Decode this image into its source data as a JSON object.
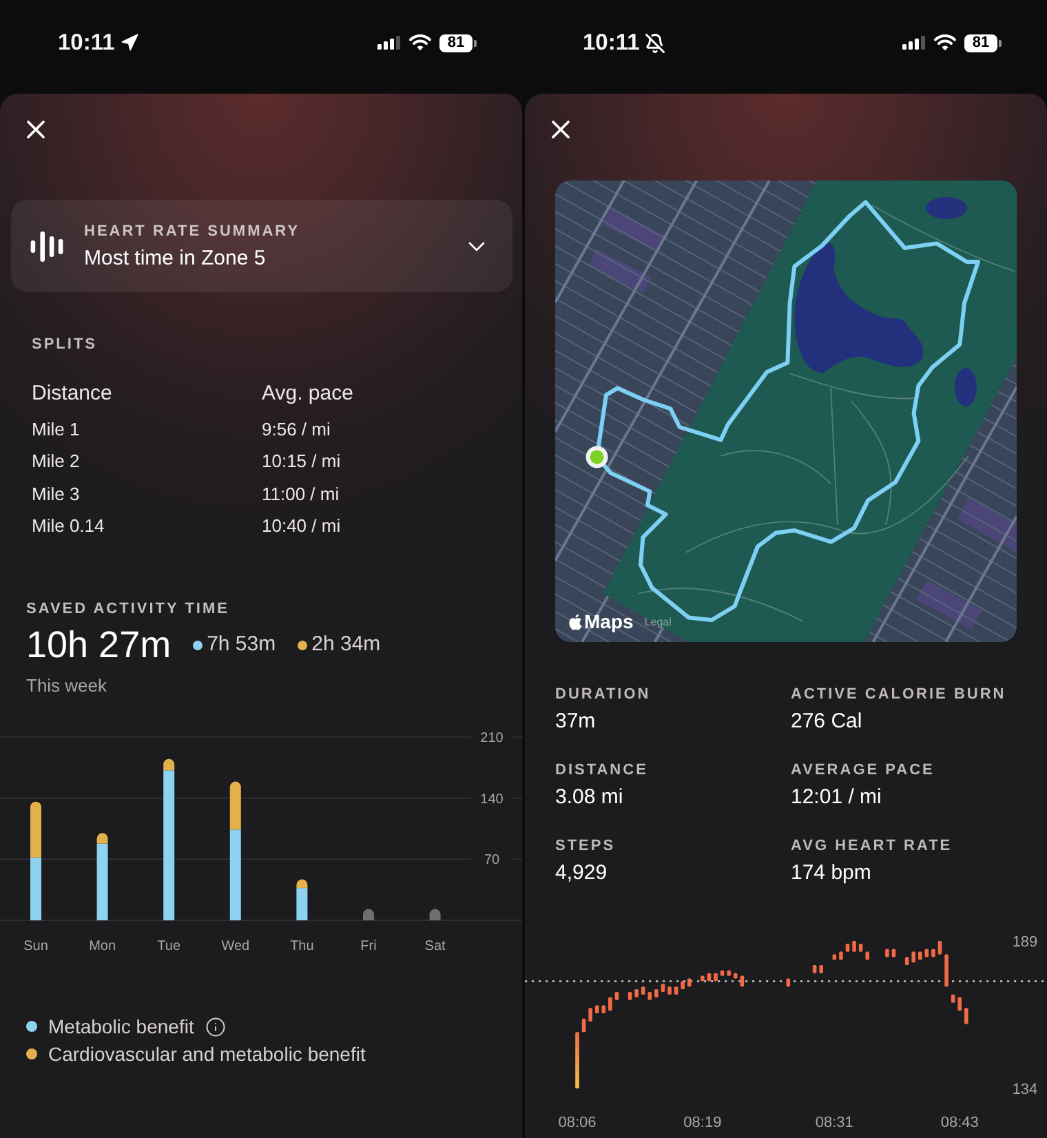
{
  "left_screen": {
    "status_bar": {
      "time": "10:11",
      "battery": "81"
    },
    "heart_rate_summary": {
      "title": "HEART RATE SUMMARY",
      "subtitle": "Most time in Zone 5",
      "expanded": false
    },
    "splits": {
      "title": "SPLITS",
      "columns": [
        "Distance",
        "Avg. pace"
      ],
      "rows": [
        [
          "Mile 1",
          "9:56 / mi"
        ],
        [
          "Mile 2",
          "10:15 / mi"
        ],
        [
          "Mile 3",
          "11:00 / mi"
        ],
        [
          "Mile 0.14",
          "10:40 / mi"
        ]
      ]
    },
    "saved_activity_time": {
      "title": "SAVED ACTIVITY TIME",
      "total": "10h 27m",
      "breakdown": [
        {
          "value": "7h 53m",
          "color": "#8ed2f2"
        },
        {
          "value": "2h 34m",
          "color": "#e3b04c"
        }
      ],
      "period": "This week",
      "chart_data": {
        "type": "bar",
        "stacked": true,
        "categories": [
          "Sun",
          "Mon",
          "Tue",
          "Wed",
          "Thu",
          "Fri",
          "Sat"
        ],
        "series": [
          {
            "color": "#8ed2f2",
            "values": [
              72,
              88,
              172,
              104,
              37,
              null,
              null
            ]
          },
          {
            "color": "#e3b04c",
            "values": [
              64,
              12,
              13,
              55,
              10,
              null,
              null
            ]
          },
          {
            "color": "#726d6e",
            "values": [
              null,
              null,
              null,
              null,
              null,
              13,
              13
            ]
          }
        ],
        "ylim": [
          0,
          210
        ],
        "yticks": [
          70,
          140,
          210
        ]
      },
      "legend": [
        {
          "label": "Metabolic benefit",
          "color": "#8ed2f2",
          "info": true
        },
        {
          "label": "Cardiovascular and metabolic benefit",
          "color": "#e3b04c",
          "info": false
        }
      ]
    }
  },
  "right_screen": {
    "status_bar": {
      "time": "10:11",
      "battery": "81"
    },
    "map": {
      "attribution": "Maps",
      "legal": "Legal"
    },
    "stats": [
      {
        "label": "DURATION",
        "value": "37m"
      },
      {
        "label": "ACTIVE CALORIE BURN",
        "value": "276 Cal"
      },
      {
        "label": "DISTANCE",
        "value": "3.08 mi"
      },
      {
        "label": "AVERAGE PACE",
        "value": "12:01 / mi"
      },
      {
        "label": "STEPS",
        "value": "4,929"
      },
      {
        "label": "AVG HEART RATE",
        "value": "174 bpm"
      }
    ],
    "heart_rate_chart": {
      "chart_data": {
        "type": "candlestick",
        "categories": [
          "08:06",
          null,
          null,
          null,
          null,
          null,
          null,
          null,
          null,
          null,
          null,
          null,
          null,
          null,
          null,
          null,
          null,
          null,
          null,
          "08:19",
          null,
          null,
          null,
          null,
          null,
          null,
          null,
          null,
          null,
          null,
          null,
          null,
          null,
          null,
          null,
          null,
          null,
          null,
          null,
          "08:31",
          null,
          null,
          null,
          null,
          null,
          null,
          null,
          null,
          null,
          null,
          null,
          null,
          null,
          null,
          null,
          null,
          null,
          null,
          "08:43",
          null
        ],
        "series": [
          {
            "color": "#f06a45",
            "ohlc": [
              [
                134,
                155,
                134,
                155
              ],
              [
                155,
                160,
                155,
                160
              ],
              [
                159,
                164,
                159,
                164
              ],
              [
                162,
                165,
                162,
                165
              ],
              [
                162,
                165,
                162,
                165
              ],
              [
                163,
                168,
                163,
                168
              ],
              [
                167,
                170,
                167,
                170
              ],
              null,
              [
                167,
                170,
                167,
                170
              ],
              [
                168,
                171,
                168,
                171
              ],
              [
                169,
                172,
                169,
                172
              ],
              [
                167,
                170,
                167,
                170
              ],
              [
                168,
                171,
                168,
                171
              ],
              [
                170,
                173,
                170,
                173
              ],
              [
                169,
                172,
                169,
                172
              ],
              [
                169,
                172,
                169,
                172
              ],
              [
                171,
                174,
                171,
                174
              ],
              [
                172,
                175,
                172,
                175
              ],
              null,
              [
                174,
                176,
                174,
                176
              ],
              [
                174,
                177,
                174,
                177
              ],
              [
                174,
                177,
                174,
                177
              ],
              [
                176,
                178,
                176,
                178
              ],
              [
                176,
                178,
                176,
                178
              ],
              [
                175,
                177,
                175,
                177
              ],
              [
                172,
                176,
                172,
                176
              ],
              null,
              null,
              null,
              null,
              null,
              null,
              [
                172,
                175,
                172,
                175
              ],
              null,
              null,
              null,
              [
                177,
                180,
                177,
                180
              ],
              [
                177,
                180,
                177,
                180
              ],
              null,
              [
                182,
                184,
                182,
                184
              ],
              [
                182,
                185,
                182,
                185
              ],
              [
                185,
                188,
                185,
                188
              ],
              [
                185,
                189,
                185,
                189
              ],
              [
                185,
                188,
                185,
                188
              ],
              [
                182,
                185,
                182,
                185
              ],
              null,
              null,
              [
                183,
                186,
                183,
                186
              ],
              [
                183,
                186,
                183,
                186
              ],
              null,
              [
                180,
                183,
                180,
                183
              ],
              [
                181,
                185,
                181,
                185
              ],
              [
                182,
                185,
                182,
                185
              ],
              [
                183,
                186,
                183,
                186
              ],
              [
                183,
                186,
                183,
                186
              ],
              [
                184,
                189,
                184,
                189
              ],
              [
                172,
                184,
                172,
                184
              ],
              [
                166,
                169,
                166,
                169
              ],
              [
                163,
                168,
                163,
                168
              ],
              [
                158,
                164,
                158,
                164
              ]
            ]
          }
        ],
        "ylim": [
          134,
          189
        ],
        "yticks": [
          134,
          189
        ],
        "ref_lines": [
          {
            "axis": "y",
            "value": 174
          }
        ]
      }
    }
  }
}
